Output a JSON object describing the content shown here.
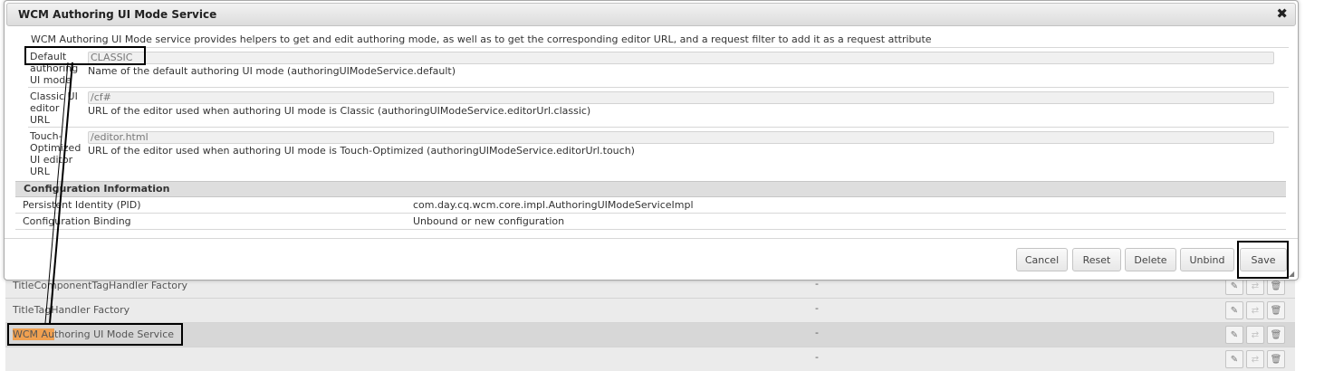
{
  "dialog": {
    "title": "WCM Authoring UI Mode Service",
    "close_icon": "close-icon",
    "description": "WCM Authoring UI Mode service provides helpers to get and edit authoring mode, as well as to get the corresponding editor URL, and a request filter to add it as a request attribute",
    "properties": [
      {
        "label_lines": [
          "Default",
          "authoring",
          "UI mode"
        ],
        "value": "CLASSIC",
        "help": "Name of the default authoring UI mode (authoringUIModeService.default)"
      },
      {
        "label_lines": [
          "Classic UI",
          "editor",
          "URL"
        ],
        "value": "/cf#",
        "help": "URL of the editor used when authoring UI mode is Classic (authoringUIModeService.editorUrl.classic)"
      },
      {
        "label_lines": [
          "Touch-",
          "Optimized",
          "UI editor",
          "URL"
        ],
        "value": "/editor.html",
        "help": "URL of the editor used when authoring UI mode is Touch-Optimized (authoringUIModeService.editorUrl.touch)"
      }
    ],
    "config": {
      "heading": "Configuration Information",
      "rows": [
        {
          "key": "Persistent Identity (PID)",
          "value": "com.day.cq.wcm.core.impl.AuthoringUIModeServiceImpl"
        },
        {
          "key": "Configuration Binding",
          "value": "Unbound or new configuration"
        }
      ]
    },
    "buttons": {
      "cancel": "Cancel",
      "reset": "Reset",
      "delete": "Delete",
      "unbind": "Unbind",
      "save": "Save"
    }
  },
  "background_list": {
    "rows": [
      {
        "name": "TitleComponentTagHandler Factory",
        "value": "-"
      },
      {
        "name": "TitleTagHandler Factory",
        "value": "-"
      },
      {
        "name_highlight": "WCM Au",
        "name_rest": "thoring UI Mode Service",
        "value": "-"
      },
      {
        "name": "",
        "value": "-"
      }
    ],
    "action_icons": [
      "pencil-icon",
      "bind-icon",
      "trash-icon"
    ]
  },
  "colors": {
    "highlight": "#f0a050",
    "annotation": "#000000"
  }
}
